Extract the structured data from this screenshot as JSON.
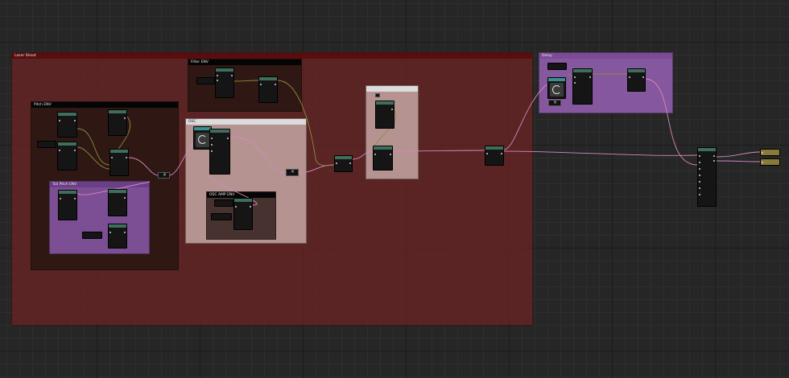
{
  "comments": {
    "laser_shoot": "Laser Shoot",
    "filter_env": "Filter ENV",
    "pitch_env": "Pitch ENV",
    "tail_pitch_env": "Tail Pitch ENV",
    "osc": "OSC",
    "osc_amp_env": "OSC AMP ENV",
    "delay": "Delay"
  },
  "colors": {
    "wire_pink": "#d58ac0",
    "wire_olive": "#8f8a3c",
    "node_header": "#3f6e5b",
    "comment_red": "#7a2222",
    "comment_purple": "#8a57a8"
  },
  "icons": {
    "reroute": "x-icon",
    "knob": "knob-icon"
  }
}
